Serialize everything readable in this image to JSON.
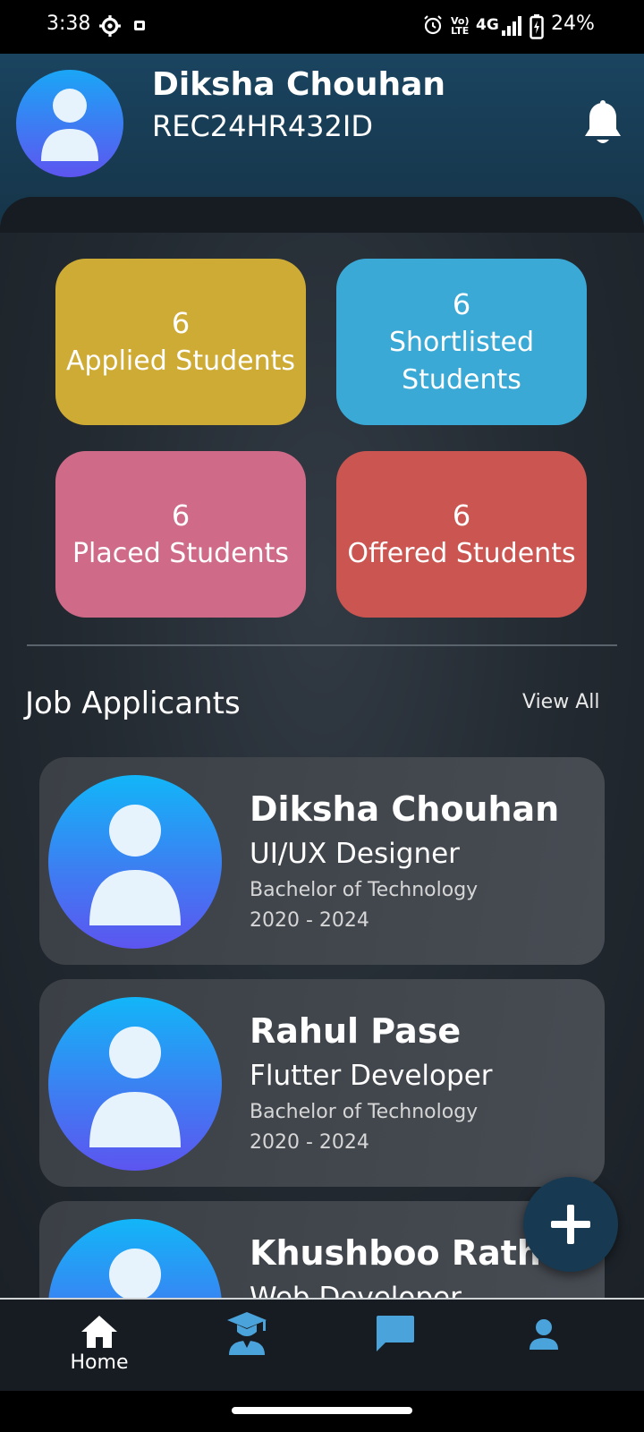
{
  "status_bar": {
    "time": "3:38",
    "battery": "24%",
    "network": "4G",
    "icons": [
      "settings-icon",
      "notification-icon",
      "alarm-icon",
      "volte-icon",
      "signal-icon",
      "battery-charging-icon"
    ]
  },
  "header": {
    "name": "Diksha Chouhan",
    "id": "REC24HR432ID",
    "bell_icon": "bell-icon"
  },
  "stats": [
    {
      "count": "6",
      "label": "Applied Students",
      "color": "#ceab35"
    },
    {
      "count": "6",
      "label": "Shortlisted Students",
      "color": "#3aa9d5"
    },
    {
      "count": "6",
      "label": "Placed Students",
      "color": "#cf6b88"
    },
    {
      "count": "6",
      "label": "Offered Students",
      "color": "#cb5550"
    }
  ],
  "applicants_section": {
    "title": "Job Applicants",
    "view_all": "View All"
  },
  "applicants": [
    {
      "name": "Diksha Chouhan",
      "role": "UI/UX Designer",
      "degree": "Bachelor of Technology",
      "years": "2020 - 2024"
    },
    {
      "name": "Rahul Pase",
      "role": "Flutter Developer",
      "degree": "Bachelor of Technology",
      "years": "2020 - 2024"
    },
    {
      "name": "Khushboo Rathor",
      "role": "Web Developer",
      "degree": "",
      "years": ""
    }
  ],
  "fab": {
    "icon": "plus-icon"
  },
  "bottom_nav": [
    {
      "label": "Home",
      "icon": "home-icon",
      "active": true
    },
    {
      "label": "",
      "icon": "graduate-icon",
      "active": false
    },
    {
      "label": "",
      "icon": "chat-icon",
      "active": false
    },
    {
      "label": "",
      "icon": "profile-icon",
      "active": false
    }
  ],
  "colors": {
    "header_bg": "#1a4460",
    "accent_blue": "#4aa3db",
    "panel_bg": "#222930"
  }
}
